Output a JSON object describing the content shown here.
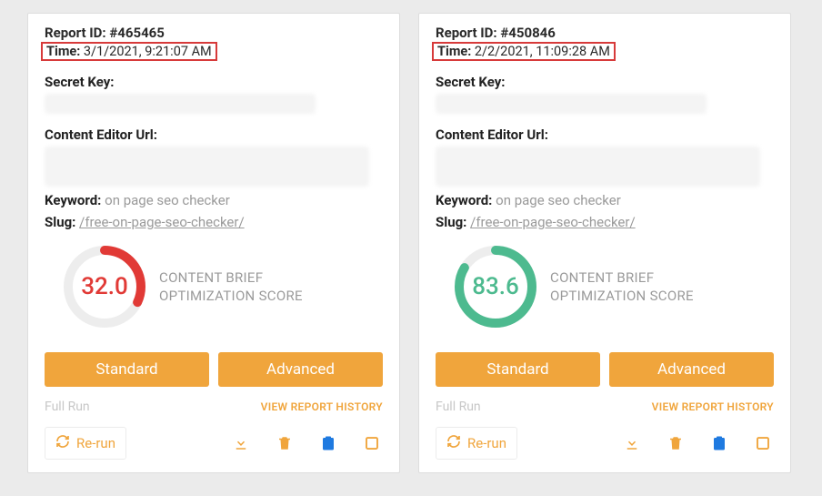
{
  "labels": {
    "reportIdPrefix": "Report ID: ",
    "timePrefix": "Time: ",
    "secretKey": "Secret Key:",
    "contentEditorUrl": "Content Editor Url:",
    "keyword": "Keyword:",
    "slug": "Slug:",
    "scoreLabel1": "CONTENT BRIEF",
    "scoreLabel2": "OPTIMIZATION SCORE",
    "standard": "Standard",
    "advanced": "Advanced",
    "fullRun": "Full Run",
    "viewHistory": "VIEW REPORT HISTORY",
    "rerun": "Re-run"
  },
  "cards": [
    {
      "reportId": "#465465",
      "time": "3/1/2021, 9:21:07 AM",
      "keyword": "on page seo checker",
      "slug": "/free-on-page-seo-checker/",
      "score": "32.0",
      "scorePct": 32,
      "scoreColor": "#e13a36"
    },
    {
      "reportId": "#450846",
      "time": "2/2/2021, 11:09:28 AM",
      "keyword": "on page seo checker",
      "slug": "/free-on-page-seo-checker/",
      "score": "83.6",
      "scorePct": 83.6,
      "scoreColor": "#4dba8f"
    }
  ]
}
